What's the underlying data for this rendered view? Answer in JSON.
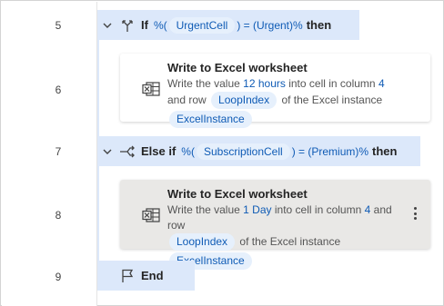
{
  "lines": [
    {
      "number": "5"
    },
    {
      "number": "6"
    },
    {
      "number": "7"
    },
    {
      "number": "8"
    },
    {
      "number": "9"
    }
  ],
  "if_block": {
    "keyword": "If",
    "open": "%(",
    "var": "UrgentCell",
    "mid": ") = (Urgent)%",
    "then": "then"
  },
  "action_1": {
    "title": "Write to Excel worksheet",
    "d1": "Write the value",
    "value": "12 hours",
    "d2": "into cell in column",
    "column": "4",
    "d3": "and row",
    "row_var": "LoopIndex",
    "d4": "of the Excel instance",
    "instance_var": "ExcelInstance"
  },
  "elseif_block": {
    "keyword": "Else if",
    "open": "%(",
    "var": "SubscriptionCell",
    "mid": ") = (Premium)%",
    "then": "then"
  },
  "action_2": {
    "title": "Write to Excel worksheet",
    "d1": "Write the value",
    "value": "1 Day",
    "d2": "into cell in column",
    "column": "4",
    "d3": "and row",
    "row_var": "LoopIndex",
    "d4": "of the Excel instance",
    "instance_var": "ExcelInstance"
  },
  "end_block": {
    "keyword": "End"
  },
  "icons": {
    "if": "if-branch-icon",
    "elseif": "elseif-branch-icon",
    "end": "end-flag-icon",
    "excel": "excel-write-icon",
    "more": "more-vertical-icon",
    "collapse": "chevron-down-icon"
  },
  "colors": {
    "control_bar": "#dce8fa",
    "variable_pill": "#e6f0fc",
    "variable_text": "#0f5bb5",
    "selected_card": "#e9e8e6"
  }
}
